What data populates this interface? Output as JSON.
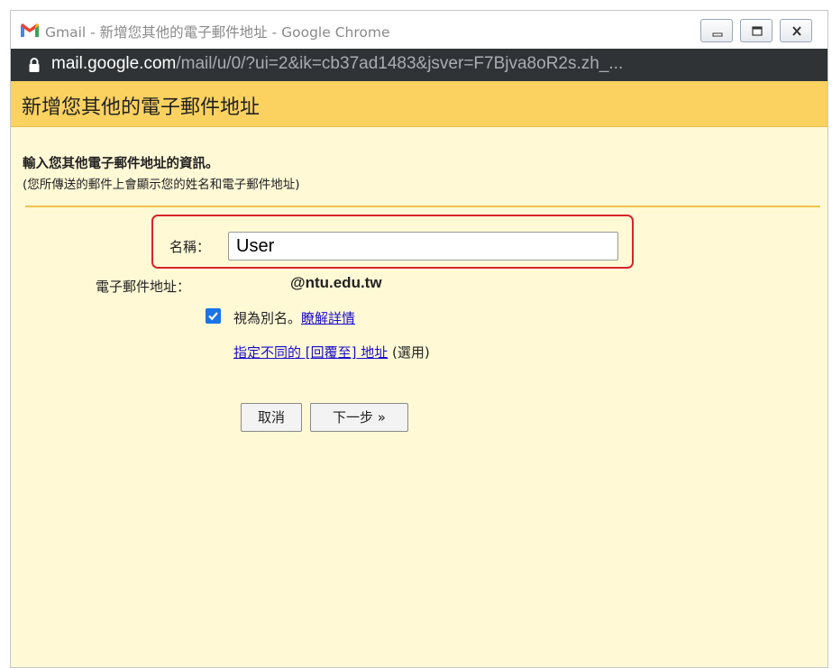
{
  "window": {
    "title": "Gmail - 新增您其他的電子郵件地址 - Google Chrome"
  },
  "url": {
    "host": "mail.google.com",
    "path": "/mail/u/0/?ui=2&ik=cb37ad1483&jsver=F7Bjva8oR2s.zh_..."
  },
  "dialog": {
    "title": "新增您其他的電子郵件地址",
    "intro": "輸入您其他電子郵件地址的資訊。",
    "intro_note": "(您所傳送的郵件上會顯示您的姓名和電子郵件地址)",
    "name_label": "名稱：",
    "name_value": "User",
    "email_label": "電子郵件地址：",
    "email_value": "@ntu.edu.tw",
    "alias_checked": true,
    "alias_label": "視為別名。",
    "alias_link": "瞭解詳情",
    "replyto_link": "指定不同的 [回覆至] 地址",
    "replyto_suffix": " (選用)",
    "cancel_label": "取消",
    "next_label": "下一步 »"
  },
  "colors": {
    "header": "#fbd260",
    "body": "#fff9d6",
    "highlight": "#d9242b",
    "link": "#1a0dcc",
    "checkbox": "#1a73e8"
  },
  "icons": [
    "gmail-logo-icon",
    "minimize-icon",
    "restore-icon",
    "close-icon",
    "lock-icon",
    "checkmark-icon"
  ]
}
